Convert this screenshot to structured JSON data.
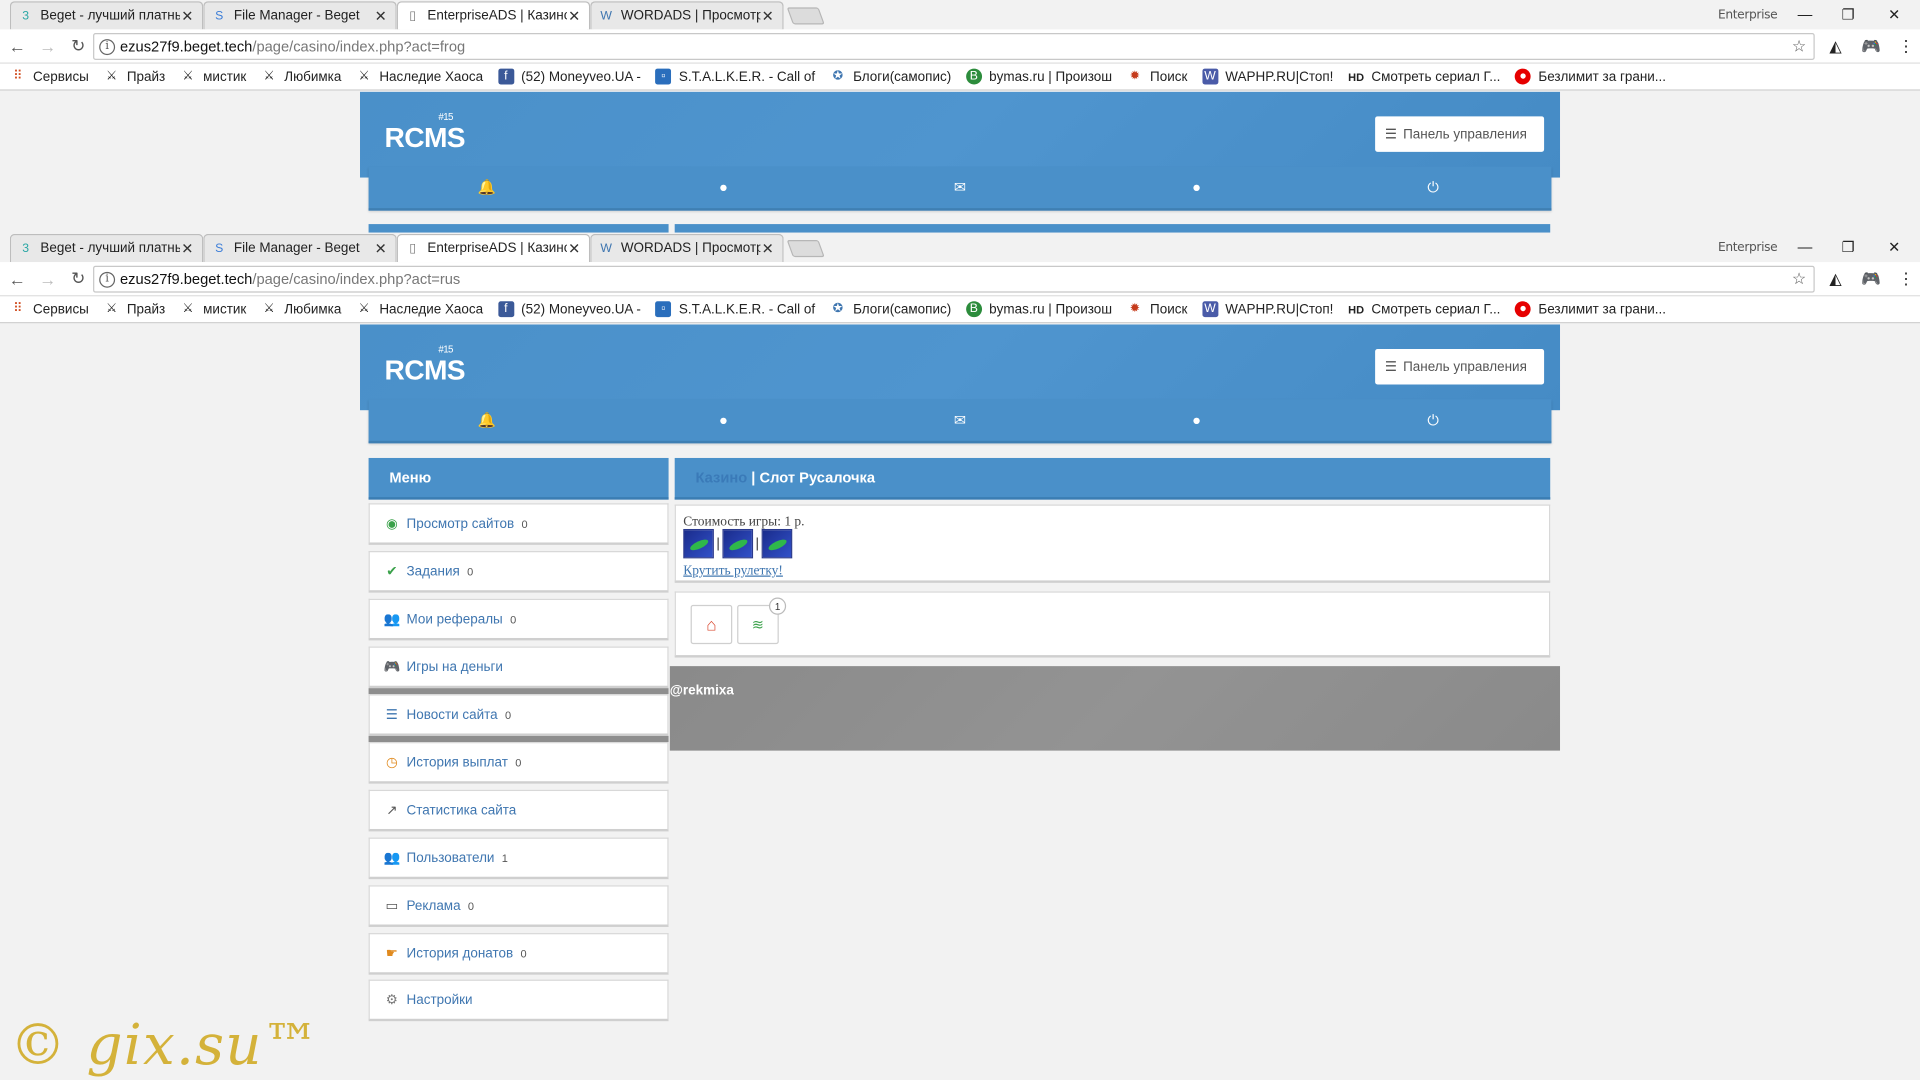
{
  "browser_top": {
    "tabs": [
      {
        "title": "Beget - лучший платный",
        "icon": "beget-icon"
      },
      {
        "title": "File Manager - Beget",
        "icon": "filemanager-icon"
      },
      {
        "title": "EnterpriseADS | Казино",
        "icon": "page-icon"
      },
      {
        "title": "WORDADS | Просмотр т",
        "icon": "w-icon"
      }
    ],
    "enterprise": "Enterprise",
    "url_host": "ezus27f9.beget.tech",
    "url_path": "/page/casino/index.php?act=frog"
  },
  "browser_main": {
    "tabs": [
      {
        "title": "Beget - лучший платный",
        "icon": "beget-icon"
      },
      {
        "title": "File Manager - Beget",
        "icon": "filemanager-icon"
      },
      {
        "title": "EnterpriseADS | Казино",
        "icon": "page-icon"
      },
      {
        "title": "WORDADS | Просмотр т",
        "icon": "w-icon"
      }
    ],
    "enterprise": "Enterprise",
    "url_host": "ezus27f9.beget.tech",
    "url_path": "/page/casino/index.php?act=rus"
  },
  "bookmarks": [
    "Сервисы",
    "Прайз",
    "мистик",
    "Любимка",
    "Наследие Хаоса",
    "(52) Moneyveo.UA -",
    "S.T.A.L.K.E.R. - Call of",
    "Блоги(самопис)",
    "bymas.ru | Произош",
    "Поиск",
    "WAPHP.RU|Стоп!",
    "Смотреть сериал Г...",
    "Безлимит за грани..."
  ],
  "site": {
    "logo": "RCMS",
    "logo_version": "#15",
    "panel_button": "Панель управления",
    "menu_title": "Меню",
    "menu": [
      {
        "label": "Просмотр сайтов",
        "count": "0",
        "icon": "eye-icon",
        "color": "#3aa14a"
      },
      {
        "label": "Задания",
        "count": "0",
        "icon": "check-icon",
        "color": "#3aa14a"
      },
      {
        "label": "Мои рефералы",
        "count": "0",
        "icon": "users-icon",
        "color": "#3f76b0"
      },
      {
        "label": "Игры на деньги",
        "count": "",
        "icon": "gamepad-icon",
        "color": "#3f76b0"
      },
      {
        "label": "Новости сайта",
        "count": "0",
        "icon": "rss-icon",
        "color": "#3f76b0"
      },
      {
        "label": "История выплат",
        "count": "0",
        "icon": "clock-icon",
        "color": "#e08a1e"
      },
      {
        "label": "Статистика сайта",
        "count": "",
        "icon": "chart-icon",
        "color": "#555555"
      },
      {
        "label": "Пользователи",
        "count": "1",
        "icon": "people-icon",
        "color": "#777777"
      },
      {
        "label": "Реклама",
        "count": "0",
        "icon": "monitor-icon",
        "color": "#555555"
      },
      {
        "label": "История донатов",
        "count": "0",
        "icon": "hand-icon",
        "color": "#e08a1e"
      },
      {
        "label": "Настройки",
        "count": "",
        "icon": "gear-icon",
        "color": "#777777"
      }
    ],
    "content_title_link": "Казино",
    "content_title_sep": " | Слот ",
    "content_title_name": "Русалочка",
    "game_cost": "Стоимость игры: 1 р.",
    "spin_link": "Крутить рулетку!",
    "badge_count": "1",
    "footer_nick": "@rekmixa"
  },
  "watermark": "© gix.su™"
}
